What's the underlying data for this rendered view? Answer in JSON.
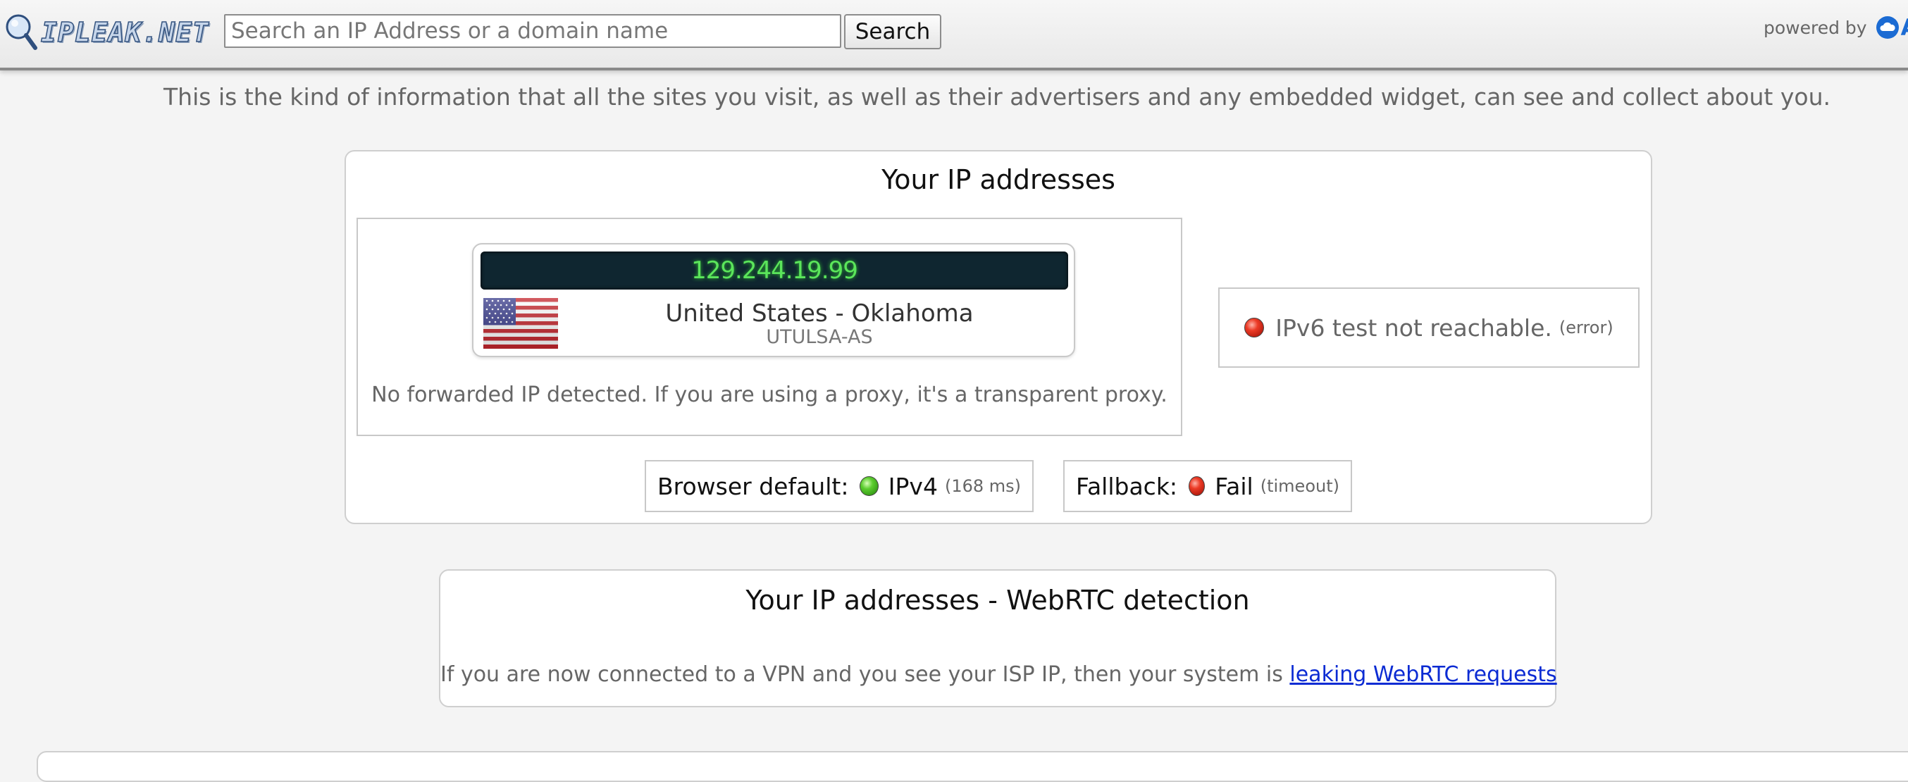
{
  "header": {
    "logo_text": "IPLEAK.NET",
    "search_placeholder": "Search an IP Address or a domain name",
    "search_value": "",
    "search_button_label": "Search",
    "powered_by_label": "powered by",
    "powered_by_brand": "A",
    "powered_by_icon": "cloud-icon"
  },
  "intro_text": "This is the kind of information that all the sites you visit, as well as their advertisers and any embedded widget, can see and collect about you.",
  "ip_section": {
    "title": "Your IP addresses",
    "ipv4": {
      "address": "129.244.19.99",
      "location": "United States - Oklahoma",
      "asn": "UTULSA-AS",
      "flag_icon": "us-flag-icon"
    },
    "forwarded_note": "No forwarded IP detected. If you are using a proxy, it's a transparent proxy.",
    "ipv6": {
      "status_color": "#e0301e",
      "message": "IPv6 test not reachable.",
      "detail": "(error)"
    },
    "browser_default": {
      "label": "Browser default:",
      "status_color": "#4cbf2a",
      "value": "IPv4",
      "detail": "(168 ms)"
    },
    "fallback": {
      "label": "Fallback:",
      "status_color": "#e0301e",
      "value": "Fail",
      "detail": "(timeout)"
    }
  },
  "webrtc_section": {
    "title": "Your IP addresses - WebRTC detection",
    "note_prefix": "If you are now connected to a VPN and you see your ISP IP, then your system is ",
    "link_text": "leaking WebRTC requests"
  },
  "colors": {
    "ip_display_bg": "#0f2630",
    "ip_display_text": "#5be55b",
    "link": "#0b2bd3",
    "brand": "#1b6bd3"
  }
}
